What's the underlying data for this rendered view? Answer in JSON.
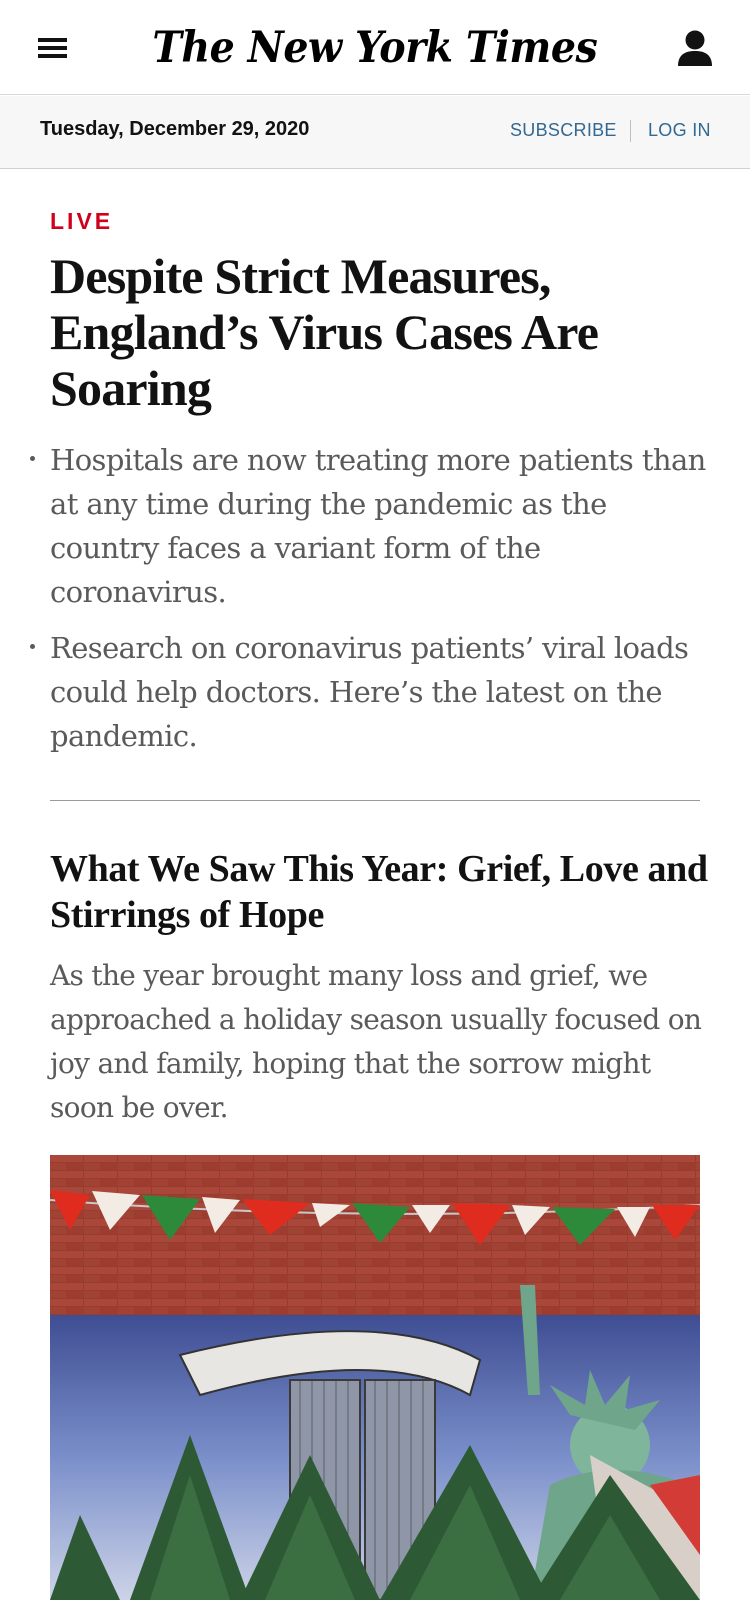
{
  "header": {
    "logo": "The New York Times",
    "date": "Tuesday, December 29, 2020",
    "subscribe": "SUBSCRIBE",
    "login": "LOG IN"
  },
  "lead_story": {
    "label": "LIVE",
    "label_color": "#d0021b",
    "headline": "Despite Strict Measures, England’s Virus Cases Are Soaring",
    "bullets": [
      "Hospitals are now treating more patients than at any time during the pandemic as the country faces a variant form of the coronavirus.",
      "Research on coronavirus patients’ viral loads could help doctors. Here’s the latest on the pandemic."
    ]
  },
  "second_story": {
    "headline": "What We Saw This Year: Grief, Love and Stirrings of Hope",
    "summary": "As the year brought many loss and grief, we approached a holiday season usually focused on joy and family, hoping that the sorrow might soon be over."
  },
  "colors": {
    "link": "#326891",
    "text": "#121212",
    "summary": "#5a5a5a"
  }
}
